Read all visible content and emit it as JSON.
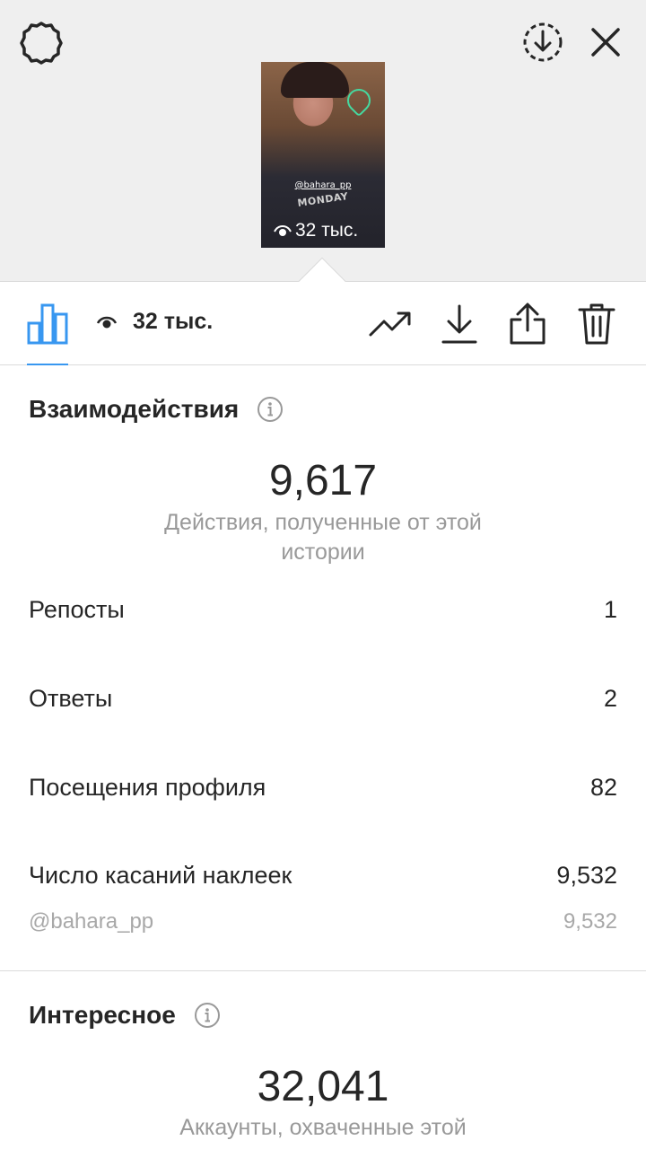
{
  "story": {
    "handle": "@bahara_pp",
    "shirt_text": "MONDAY",
    "views": "32 тыс."
  },
  "toolbar": {
    "views": "32 тыс."
  },
  "interactions": {
    "title": "Взаимодействия",
    "value": "9,617",
    "caption": "Действия, полученные от этой истории",
    "rows": [
      {
        "label": "Репосты",
        "value": "1"
      },
      {
        "label": "Ответы",
        "value": "2"
      },
      {
        "label": "Посещения профиля",
        "value": "82"
      },
      {
        "label": "Число касаний наклеек",
        "value": "9,532"
      }
    ],
    "sub_row": {
      "label": "@bahara_pp",
      "value": "9,532"
    }
  },
  "discovery": {
    "title": "Интересное",
    "value": "32,041",
    "caption": "Аккаунты, охваченные этой"
  },
  "colors": {
    "accent": "#3897f0",
    "text": "#262626",
    "muted": "#999999"
  },
  "icons": [
    "settings-icon",
    "download-circle-icon",
    "close-icon",
    "bar-chart-icon",
    "eye-icon",
    "trend-icon",
    "download-icon",
    "share-icon",
    "trash-icon",
    "info-icon"
  ]
}
